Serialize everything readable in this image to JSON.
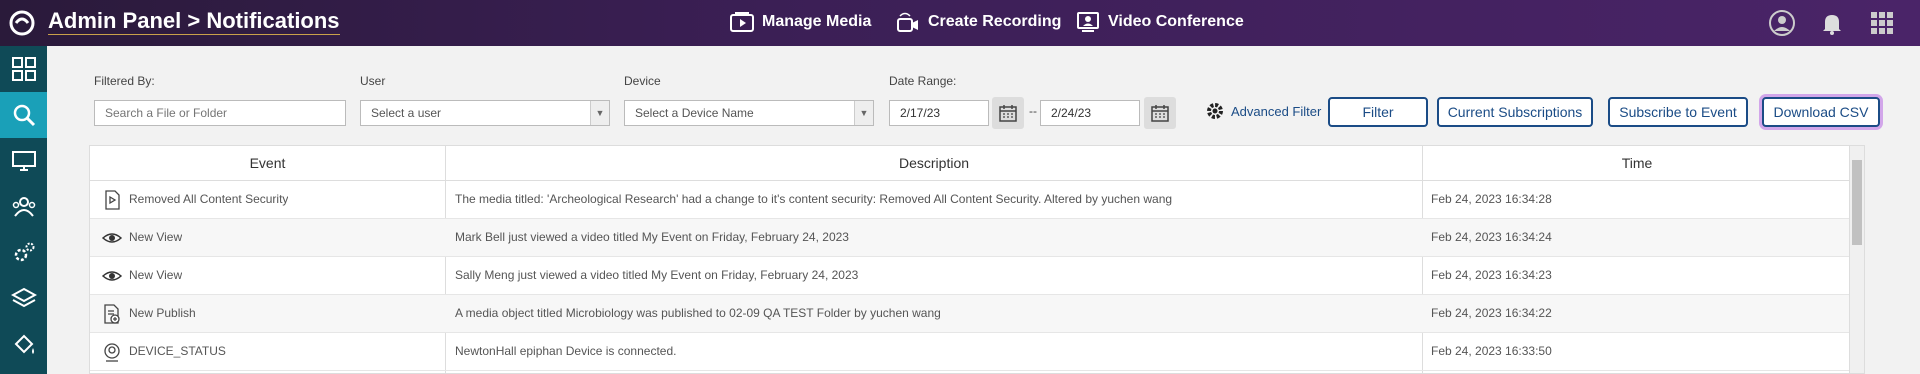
{
  "header": {
    "title": "Admin Panel > Notifications",
    "nav": [
      {
        "label": "Manage Media",
        "icon": "media-icon"
      },
      {
        "label": "Create Recording",
        "icon": "camera-icon"
      },
      {
        "label": "Video Conference",
        "icon": "video-conference-icon"
      }
    ],
    "right_icons": [
      "user-icon",
      "bell-icon",
      "apps-grid-icon"
    ]
  },
  "sidebar": {
    "items": [
      "dashboard-icon",
      "search-icon",
      "monitor-icon",
      "users-icon",
      "settings-icon",
      "layers-icon",
      "paint-bucket-icon"
    ],
    "active_index": 1
  },
  "filters": {
    "filtered_by_label": "Filtered By:",
    "file_placeholder": "Search a File or Folder",
    "user_label": "User",
    "user_value": "Select a user",
    "device_label": "Device",
    "device_value": "Select a Device Name",
    "date_range_label": "Date Range:",
    "date_from": "2/17/23",
    "date_sep": "--",
    "date_to": "2/24/23",
    "advanced_filter": "Advanced Filter",
    "filter_button": "Filter",
    "current_subscriptions_button": "Current Subscriptions",
    "subscribe_button": "Subscribe to Event",
    "download_button": "Download CSV"
  },
  "table": {
    "headers": [
      "Event",
      "Description",
      "Time"
    ],
    "rows": [
      {
        "icon": "content-security-icon",
        "event": "Removed All Content Security",
        "description": "The media titled: 'Archeological Research' had a change to it's content security: Removed All Content Security. Altered by yuchen wang",
        "time": "Feb 24, 2023 16:34:28"
      },
      {
        "icon": "eye-icon",
        "event": "New View",
        "description": "Mark Bell just viewed a video titled My Event on Friday, February 24, 2023",
        "time": "Feb 24, 2023 16:34:24"
      },
      {
        "icon": "eye-icon",
        "event": "New View",
        "description": "Sally Meng just viewed a video titled My Event on Friday, February 24, 2023",
        "time": "Feb 24, 2023 16:34:23"
      },
      {
        "icon": "publish-icon",
        "event": "New Publish",
        "description": "A media object titled Microbiology was published to 02-09 QA TEST Folder by yuchen wang",
        "time": "Feb 24, 2023 16:34:22"
      },
      {
        "icon": "device-status-icon",
        "event": "DEVICE_STATUS",
        "description": "NewtonHall epiphan Device is connected.",
        "time": "Feb 24, 2023 16:33:50"
      }
    ]
  }
}
